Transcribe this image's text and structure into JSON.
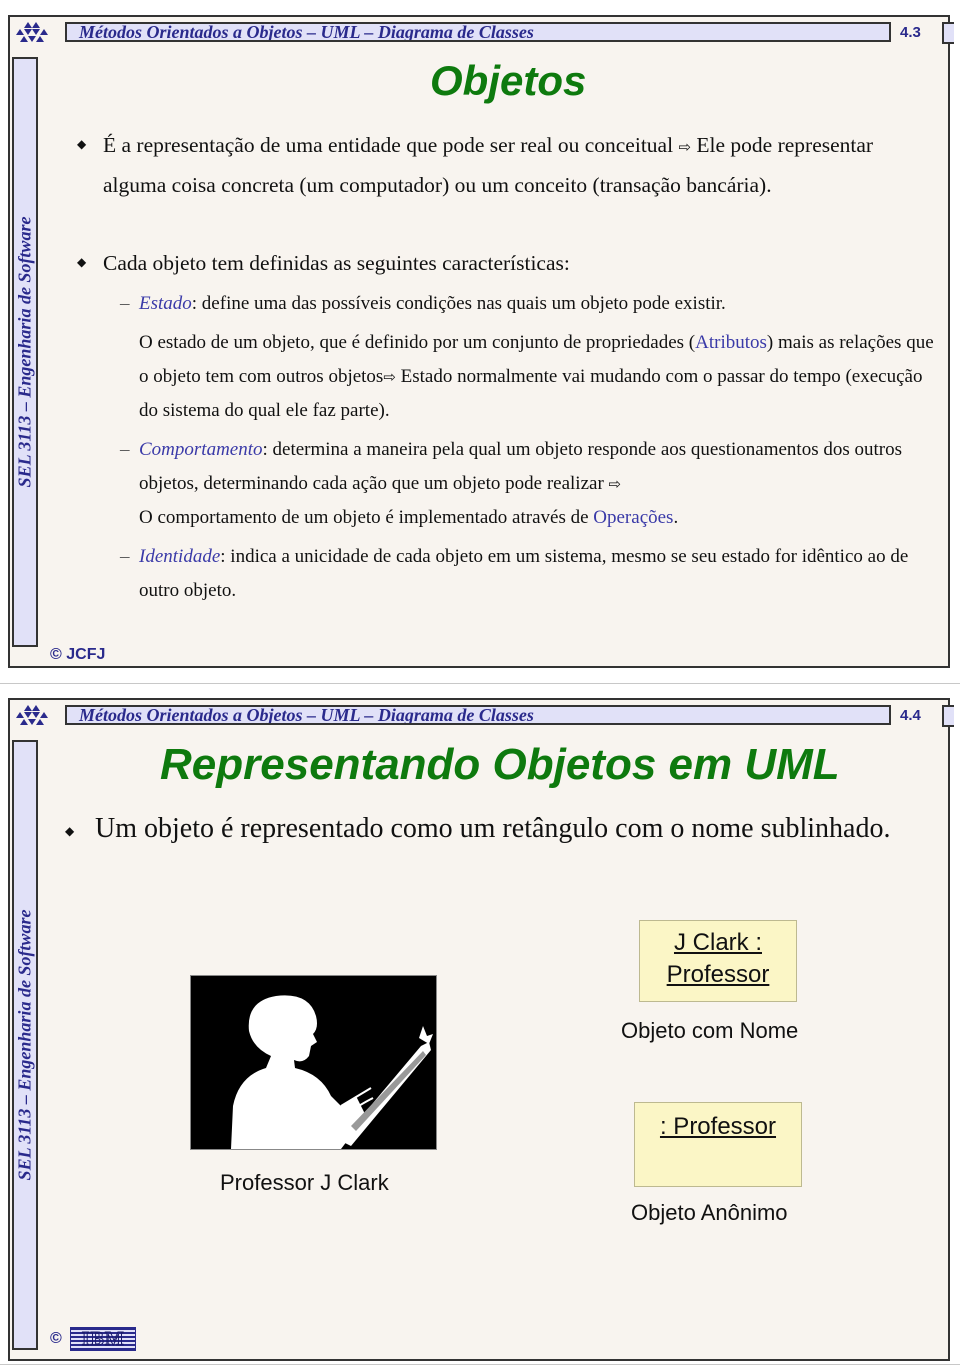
{
  "slides": [
    {
      "header": "Métodos Orientados a Objetos – UML – Diagrama de Classes",
      "number": "4.3",
      "sidebar": "SEL 3113 – Engenharia de Software",
      "title": "Objetos",
      "bullets": [
        {
          "text_before": "É a representação de uma entidade que pode ser real ou conceitual ",
          "arrow": "⇨",
          "text_after": " Ele pode representar alguma coisa concreta (um computador) ou um conceito (transação bancária)."
        },
        {
          "text": "Cada objeto tem definidas as seguintes características:",
          "subitems": [
            {
              "dash": "–",
              "term": "Estado",
              "definition": ": define uma das possíveis condições nas quais um objeto pode existir.",
              "detail_before": "O estado de um objeto, que é definido por um conjunto de propriedades (",
              "detail_link": "Atributos",
              "detail_mid": ") mais as relações que o objeto tem com outros objetos",
              "arrow": "⇨",
              "detail_after": " Estado normalmente vai mudando com o passar do tempo (execução do sistema do qual ele faz parte)."
            },
            {
              "dash": "–",
              "term": "Comportamento",
              "definition": ": determina a maneira pela qual um objeto responde aos questionamentos dos outros objetos, determinando cada ação que um objeto pode realizar ",
              "arrow": "⇨",
              "detail_before": "O comportamento de um objeto é implementado através de ",
              "detail_link": "Operações",
              "detail_after": "."
            },
            {
              "dash": "–",
              "term": "Identidade",
              "definition": ": indica a unicidade de cada objeto em um sistema, mesmo se seu estado for idêntico ao de outro objeto."
            }
          ]
        }
      ],
      "copyright_symbol": "©",
      "copyright": "JCFJ"
    },
    {
      "header": "Métodos Orientados a Objetos – UML – Diagrama de Classes",
      "number": "4.4",
      "sidebar": "SEL 3113 – Engenharia de Software",
      "title": "Representando Objetos em UML",
      "bullet": "Um objeto é representado como um retângulo com o nome sublinhado.",
      "photo_caption": "Professor J Clark",
      "named_object": {
        "line1": "J Clark :",
        "line2": "Professor",
        "caption": "Objeto com Nome"
      },
      "anonymous_object": {
        "line1": ": Professor",
        "caption": "Objeto Anônimo"
      },
      "copyright_symbol": "©",
      "copyright_logo": "IBM"
    }
  ],
  "colors": {
    "title_green": "#0e7a0e",
    "header_blue": "#2a2a8c",
    "header_bg": "#e1e1f8",
    "slide_bg": "#f8f4ef",
    "uml_box": "#fbf6c6"
  }
}
